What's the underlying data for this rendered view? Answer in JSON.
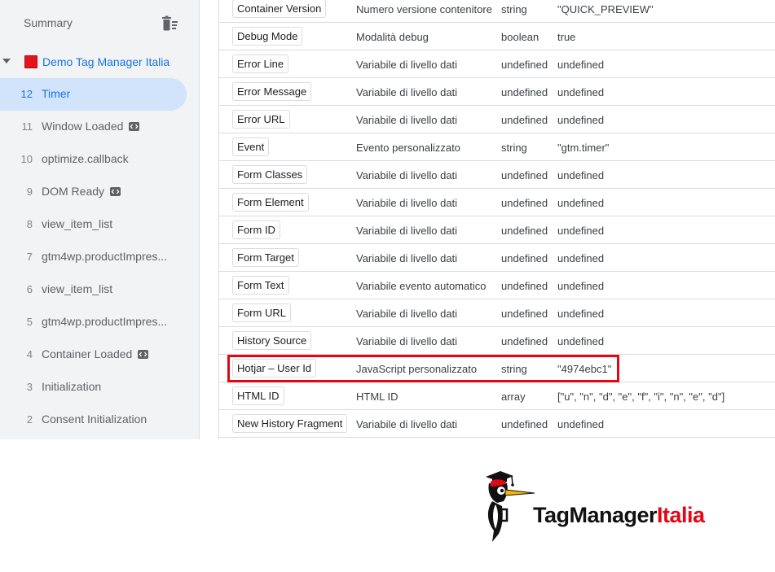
{
  "sidebar": {
    "summary_label": "Summary",
    "summary_icon": "clear-delete-icon",
    "container": {
      "name": "Demo Tag Manager Italia",
      "color": "#e3141c"
    },
    "events": [
      {
        "num": "12",
        "label": "Timer",
        "active": true,
        "code_badge": false
      },
      {
        "num": "11",
        "label": "Window Loaded",
        "active": false,
        "code_badge": true
      },
      {
        "num": "10",
        "label": "optimize.callback",
        "active": false,
        "code_badge": false
      },
      {
        "num": "9",
        "label": "DOM Ready",
        "active": false,
        "code_badge": true
      },
      {
        "num": "8",
        "label": "view_item_list",
        "active": false,
        "code_badge": false
      },
      {
        "num": "7",
        "label": "gtm4wp.productImpres...",
        "active": false,
        "code_badge": false
      },
      {
        "num": "6",
        "label": "view_item_list",
        "active": false,
        "code_badge": false
      },
      {
        "num": "5",
        "label": "gtm4wp.productImpres...",
        "active": false,
        "code_badge": false
      },
      {
        "num": "4",
        "label": "Container Loaded",
        "active": false,
        "code_badge": true
      },
      {
        "num": "3",
        "label": "Initialization",
        "active": false,
        "code_badge": false
      },
      {
        "num": "2",
        "label": "Consent Initialization",
        "active": false,
        "code_badge": false
      }
    ]
  },
  "variables": [
    {
      "name": "Container Version",
      "type": "Numero versione contenitore",
      "dtype": "string",
      "value": "\"QUICK_PREVIEW\""
    },
    {
      "name": "Debug Mode",
      "type": "Modalità debug",
      "dtype": "boolean",
      "value": "true"
    },
    {
      "name": "Error Line",
      "type": "Variabile di livello dati",
      "dtype": "undefined",
      "value": "undefined"
    },
    {
      "name": "Error Message",
      "type": "Variabile di livello dati",
      "dtype": "undefined",
      "value": "undefined"
    },
    {
      "name": "Error URL",
      "type": "Variabile di livello dati",
      "dtype": "undefined",
      "value": "undefined"
    },
    {
      "name": "Event",
      "type": "Evento personalizzato",
      "dtype": "string",
      "value": "\"gtm.timer\""
    },
    {
      "name": "Form Classes",
      "type": "Variabile di livello dati",
      "dtype": "undefined",
      "value": "undefined"
    },
    {
      "name": "Form Element",
      "type": "Variabile di livello dati",
      "dtype": "undefined",
      "value": "undefined"
    },
    {
      "name": "Form ID",
      "type": "Variabile di livello dati",
      "dtype": "undefined",
      "value": "undefined"
    },
    {
      "name": "Form Target",
      "type": "Variabile di livello dati",
      "dtype": "undefined",
      "value": "undefined"
    },
    {
      "name": "Form Text",
      "type": "Variabile evento automatico",
      "dtype": "undefined",
      "value": "undefined"
    },
    {
      "name": "Form URL",
      "type": "Variabile di livello dati",
      "dtype": "undefined",
      "value": "undefined"
    },
    {
      "name": "History Source",
      "type": "Variabile di livello dati",
      "dtype": "undefined",
      "value": "undefined"
    },
    {
      "name": "Hotjar – User Id",
      "type": "JavaScript personalizzato",
      "dtype": "string",
      "value": "\"4974ebc1\"",
      "highlighted": true
    },
    {
      "name": "HTML ID",
      "type": "HTML ID",
      "dtype": "array",
      "value": "[\"u\", \"n\", \"d\", \"e\", \"f\", \"i\", \"n\", \"e\", \"d\"]"
    },
    {
      "name": "New History Fragment",
      "type": "Variabile di livello dati",
      "dtype": "undefined",
      "value": "undefined"
    }
  ],
  "highlight_color": "#e30613",
  "logo": {
    "text_part1": "TagManager",
    "text_part2": "Italia",
    "icon": "woodpecker-mascot-icon"
  }
}
